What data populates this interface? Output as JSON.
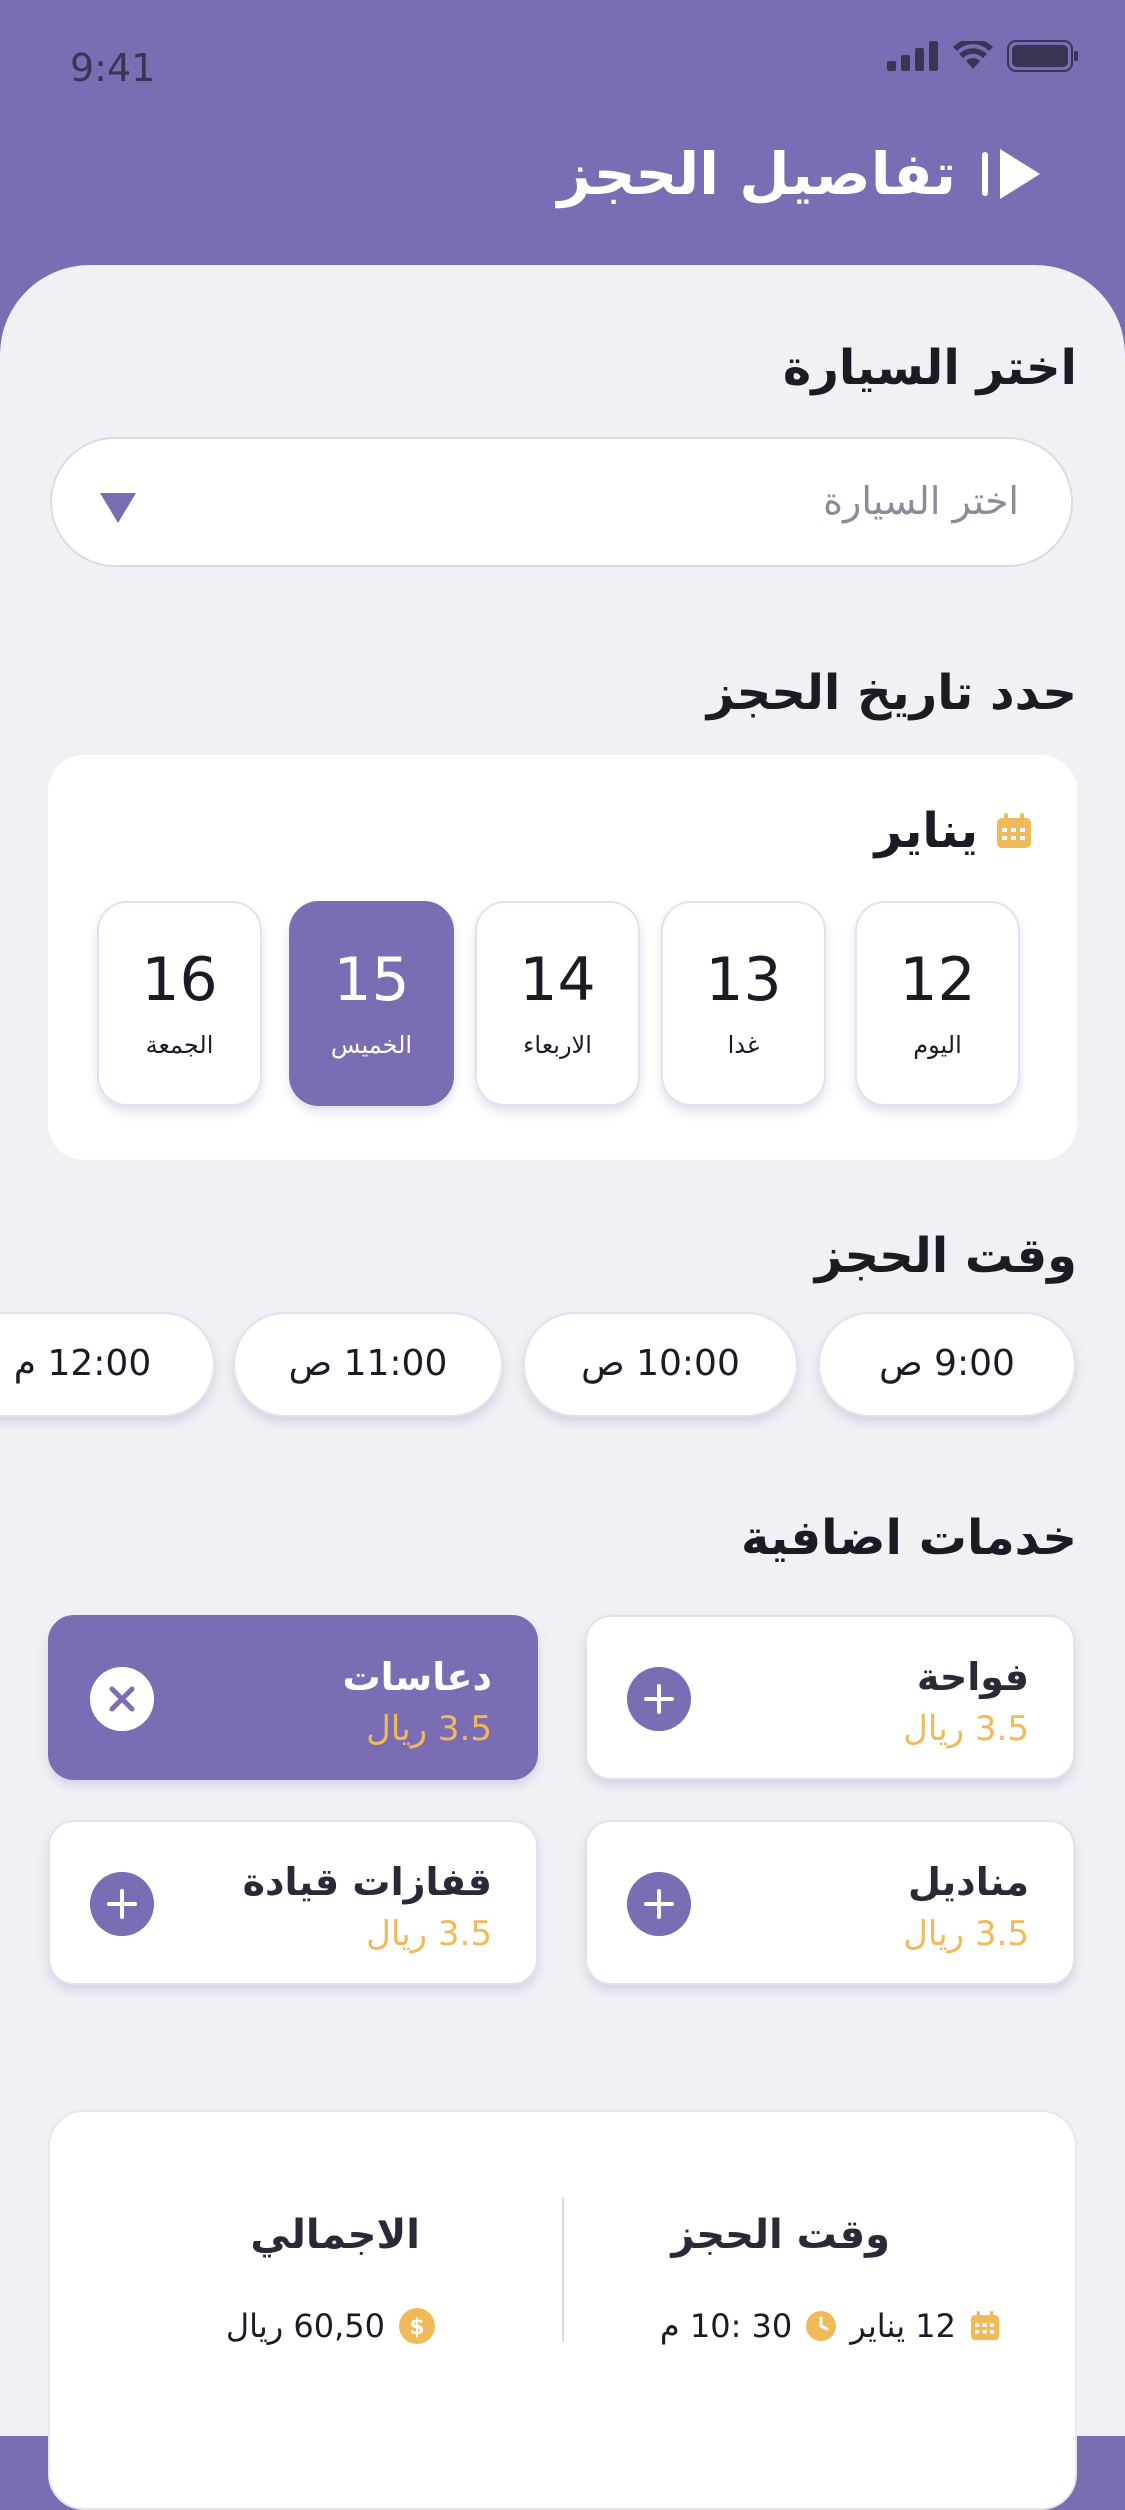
{
  "status_bar": {
    "time": "9:41"
  },
  "header": {
    "title": "تفاصيل الحجز",
    "back_icon": "play-arrow-icon"
  },
  "car_section": {
    "title": "اختر السيارة",
    "select_placeholder": "اختر السيارة"
  },
  "date_section": {
    "title": "حدد تاريخ الحجز",
    "month": "يناير",
    "days": [
      {
        "number": "12",
        "label": "اليوم",
        "selected": false
      },
      {
        "number": "13",
        "label": "غدا",
        "selected": false
      },
      {
        "number": "14",
        "label": "الاربعاء",
        "selected": false
      },
      {
        "number": "15",
        "label": "الخميس",
        "selected": true
      },
      {
        "number": "16",
        "label": "الجمعة",
        "selected": false
      }
    ]
  },
  "time_section": {
    "title": "وقت الحجز",
    "slots": [
      "9:00 ص",
      "10:00 ص",
      "11:00 ص",
      "12:00 م"
    ]
  },
  "services_section": {
    "title": "خدمات اضافية",
    "items": [
      {
        "name": "فواحة",
        "price": "3.5 ريال",
        "selected": false
      },
      {
        "name": "دعاسات",
        "price": "3.5 ريال",
        "selected": true
      },
      {
        "name": "مناديل",
        "price": "3.5 ريال",
        "selected": false
      },
      {
        "name": "قفازات قيادة",
        "price": "3.5 ريال",
        "selected": false
      }
    ]
  },
  "summary": {
    "time_title": "وقت الحجز",
    "date_value": "12 يناير",
    "time_value": "30 :10 م",
    "total_title": "الاجمالي",
    "total_value": "60,50 ريال"
  },
  "colors": {
    "primary": "#7b6db3",
    "accent": "#f0b95a",
    "background": "#f2f0f5"
  }
}
